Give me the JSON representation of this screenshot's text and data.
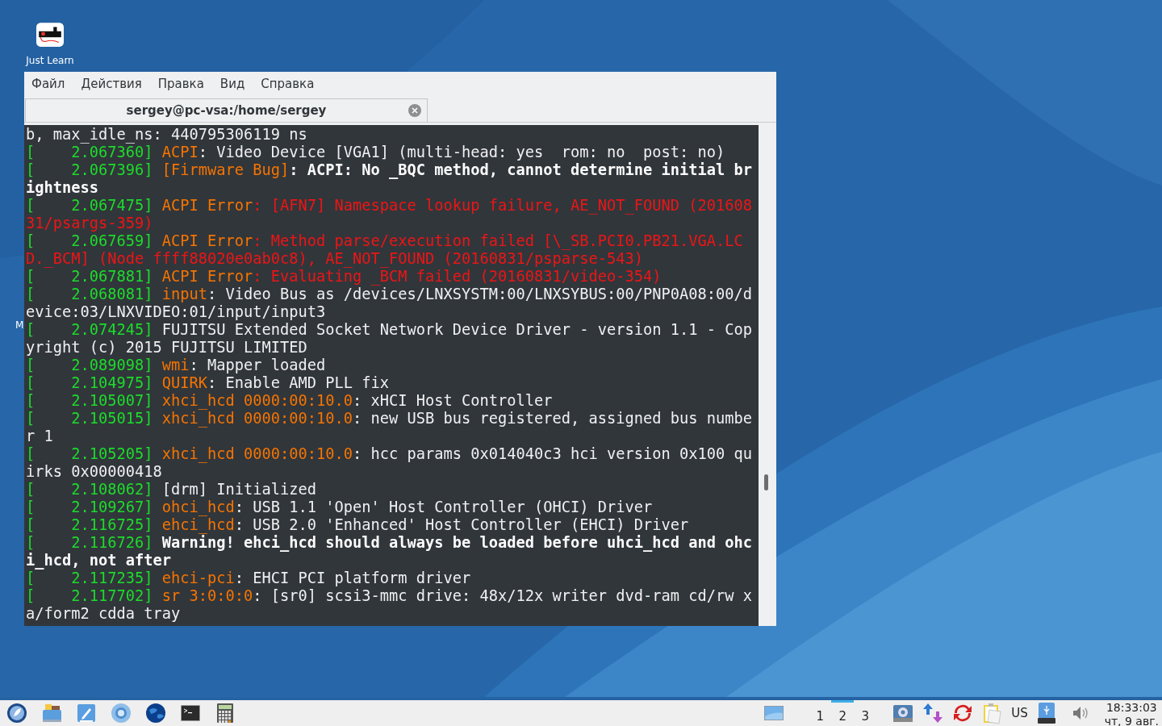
{
  "desktop": {
    "icon_label": "Just Learn",
    "edge_label": "M"
  },
  "window": {
    "menu": [
      "Файл",
      "Действия",
      "Правка",
      "Вид",
      "Справка"
    ],
    "tab": {
      "title": "sergey@pc-vsa:/home/sergey"
    },
    "terminal": {
      "lines": [
        [
          {
            "kind": "text",
            "text": "b, max_idle_ns: 440795306119 ns"
          }
        ],
        [
          {
            "kind": "ts",
            "text": "[    2.067360] "
          },
          {
            "kind": "src",
            "text": "ACPI"
          },
          {
            "kind": "text",
            "text": ": Video Device [VGA1] (multi-head: yes  rom: no  post: no)"
          }
        ],
        [
          {
            "kind": "ts",
            "text": "[    2.067396] "
          },
          {
            "kind": "src",
            "text": "[Firmware Bug]"
          },
          {
            "kind": "bold",
            "text": ": ACPI: No _BQC method, cannot determine initial brightness"
          }
        ],
        [
          {
            "kind": "ts",
            "text": "[    2.067475] "
          },
          {
            "kind": "src",
            "text": "ACPI Error"
          },
          {
            "kind": "err",
            "text": ": [AFN7] Namespace lookup failure, AE_NOT_FOUND (20160831/psargs-359)"
          }
        ],
        [
          {
            "kind": "ts",
            "text": "[    2.067659] "
          },
          {
            "kind": "src",
            "text": "ACPI Error"
          },
          {
            "kind": "err",
            "text": ": Method parse/execution failed [\\_SB.PCI0.PB21.VGA.LCD._BCM] (Node ffff88020e0ab0c8), AE_NOT_FOUND (20160831/psparse-543)"
          }
        ],
        [
          {
            "kind": "ts",
            "text": "[    2.067881] "
          },
          {
            "kind": "src",
            "text": "ACPI Error"
          },
          {
            "kind": "err",
            "text": ": Evaluating _BCM failed (20160831/video-354)"
          }
        ],
        [
          {
            "kind": "ts",
            "text": "[    2.068081] "
          },
          {
            "kind": "src",
            "text": "input"
          },
          {
            "kind": "text",
            "text": ": Video Bus as /devices/LNXSYSTM:00/LNXSYBUS:00/PNP0A08:00/device:03/LNXVIDEO:01/input/input3"
          }
        ],
        [
          {
            "kind": "ts",
            "text": "[    2.074245]"
          },
          {
            "kind": "text",
            "text": " FUJITSU Extended Socket Network Device Driver - version 1.1 - Copyright (c) 2015 FUJITSU LIMITED"
          }
        ],
        [
          {
            "kind": "ts",
            "text": "[    2.089098] "
          },
          {
            "kind": "src",
            "text": "wmi"
          },
          {
            "kind": "text",
            "text": ": Mapper loaded"
          }
        ],
        [
          {
            "kind": "ts",
            "text": "[    2.104975] "
          },
          {
            "kind": "src",
            "text": "QUIRK"
          },
          {
            "kind": "text",
            "text": ": Enable AMD PLL fix"
          }
        ],
        [
          {
            "kind": "ts",
            "text": "[    2.105007] "
          },
          {
            "kind": "src",
            "text": "xhci_hcd 0000:00:10.0"
          },
          {
            "kind": "text",
            "text": ": xHCI Host Controller"
          }
        ],
        [
          {
            "kind": "ts",
            "text": "[    2.105015] "
          },
          {
            "kind": "src",
            "text": "xhci_hcd 0000:00:10.0"
          },
          {
            "kind": "text",
            "text": ": new USB bus registered, assigned bus number 1"
          }
        ],
        [
          {
            "kind": "ts",
            "text": "[    2.105205] "
          },
          {
            "kind": "src",
            "text": "xhci_hcd 0000:00:10.0"
          },
          {
            "kind": "text",
            "text": ": hcc params 0x014040c3 hci version 0x100 quirks 0x00000418"
          }
        ],
        [
          {
            "kind": "ts",
            "text": "[    2.108062]"
          },
          {
            "kind": "text",
            "text": " [drm] Initialized"
          }
        ],
        [
          {
            "kind": "ts",
            "text": "[    2.109267] "
          },
          {
            "kind": "src",
            "text": "ohci_hcd"
          },
          {
            "kind": "text",
            "text": ": USB 1.1 'Open' Host Controller (OHCI) Driver"
          }
        ],
        [
          {
            "kind": "ts",
            "text": "[    2.116725] "
          },
          {
            "kind": "src",
            "text": "ehci_hcd"
          },
          {
            "kind": "text",
            "text": ": USB 2.0 'Enhanced' Host Controller (EHCI) Driver"
          }
        ],
        [
          {
            "kind": "ts",
            "text": "[    2.116726] "
          },
          {
            "kind": "bold",
            "text": "Warning! ehci_hcd should always be loaded before uhci_hcd and ohci_hcd, not after"
          }
        ],
        [
          {
            "kind": "ts",
            "text": "[    2.117235] "
          },
          {
            "kind": "src",
            "text": "ehci-pci"
          },
          {
            "kind": "text",
            "text": ": EHCI PCI platform driver"
          }
        ],
        [
          {
            "kind": "ts",
            "text": "[    2.117702] "
          },
          {
            "kind": "src",
            "text": "sr 3:0:0:0"
          },
          {
            "kind": "text",
            "text": ": [sr0] scsi3-mmc drive: 48x/12x writer dvd-ram cd/rw xa/form2 cdda tray"
          }
        ]
      ]
    }
  },
  "taskbar": {
    "workspaces": [
      {
        "label": "1",
        "selected": false
      },
      {
        "label": "2",
        "selected": true
      },
      {
        "label": "3",
        "selected": false
      }
    ],
    "keyboard_layout": "US",
    "clock": {
      "time": "18:33:03",
      "date": "чт, 9 авг."
    }
  }
}
